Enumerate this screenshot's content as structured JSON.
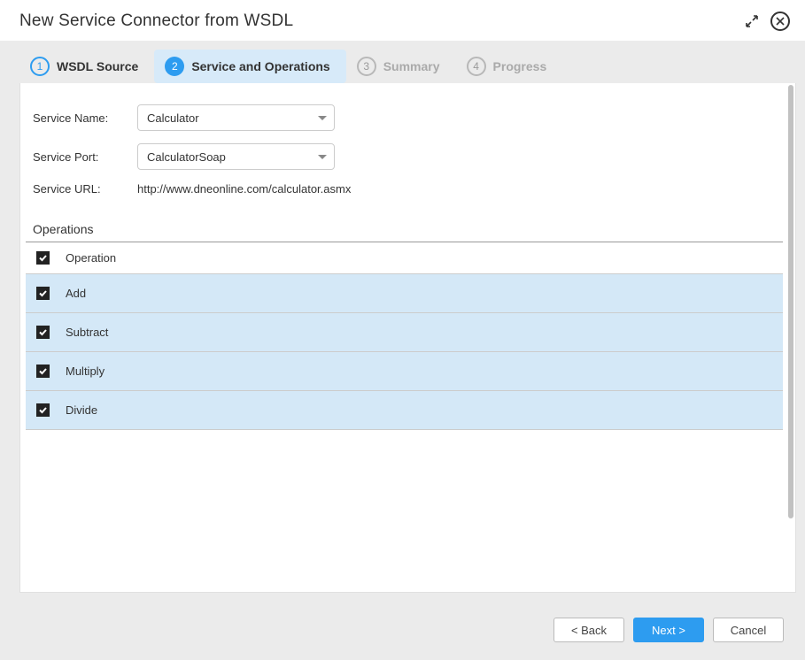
{
  "header": {
    "title": "New Service Connector from WSDL"
  },
  "tabs": [
    {
      "num": "1",
      "label": "WSDL Source"
    },
    {
      "num": "2",
      "label": "Service and Operations"
    },
    {
      "num": "3",
      "label": "Summary"
    },
    {
      "num": "4",
      "label": "Progress"
    }
  ],
  "form": {
    "service_name_label": "Service Name:",
    "service_name_value": "Calculator",
    "service_port_label": "Service Port:",
    "service_port_value": "CalculatorSoap",
    "service_url_label": "Service URL:",
    "service_url_value": "http://www.dneonline.com/calculator.asmx"
  },
  "operations": {
    "title": "Operations",
    "col_header": "Operation",
    "rows": [
      {
        "name": "Add"
      },
      {
        "name": "Subtract"
      },
      {
        "name": "Multiply"
      },
      {
        "name": "Divide"
      }
    ]
  },
  "footer": {
    "back": "< Back",
    "next": "Next >",
    "cancel": "Cancel"
  }
}
